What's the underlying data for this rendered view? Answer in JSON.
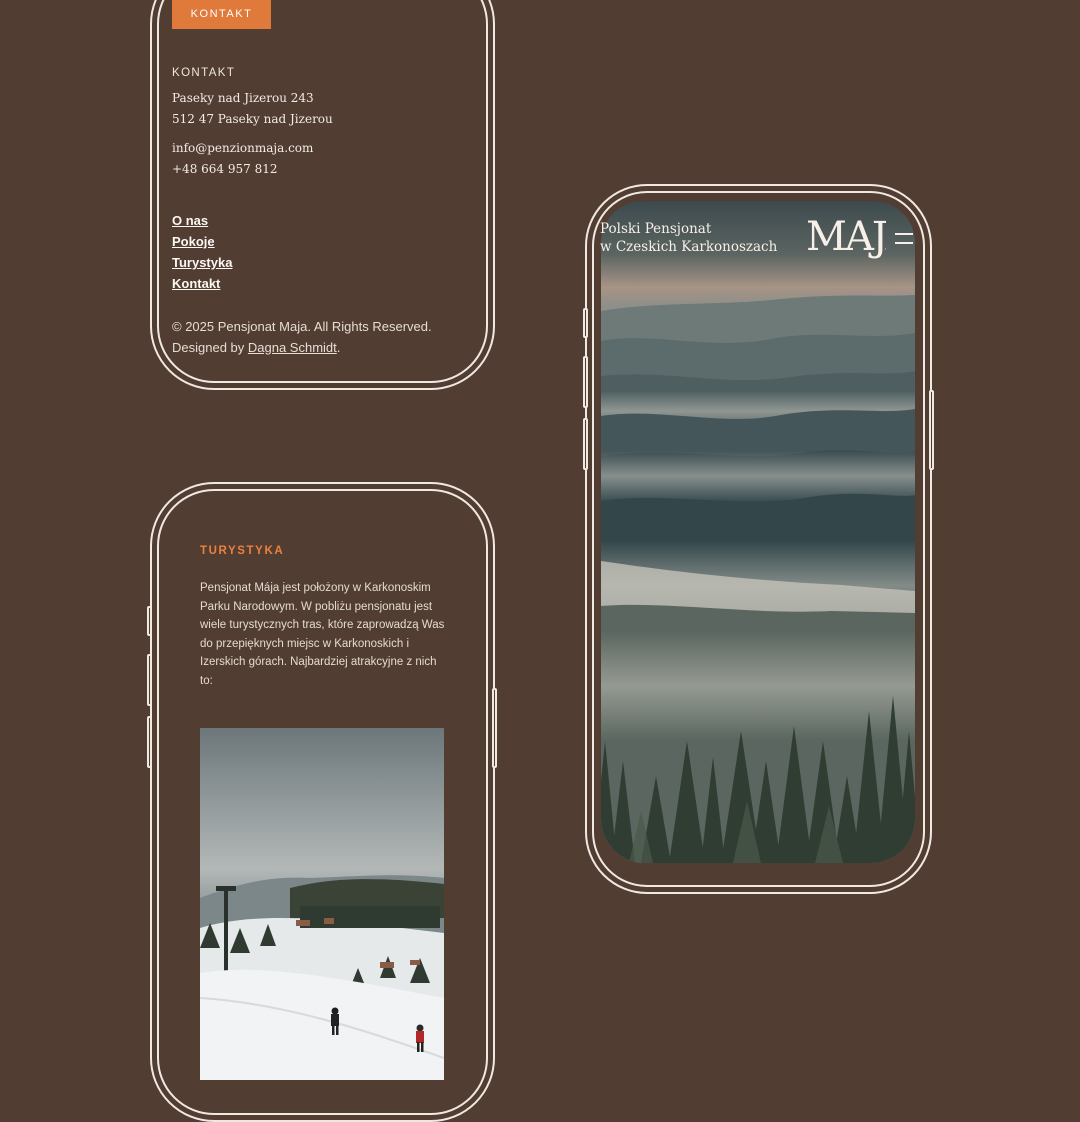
{
  "footer": {
    "contact_button": "KONTAKT",
    "contact_heading": "KONTAKT",
    "address_line1": "Paseky nad Jizerou 243",
    "address_line2": "512 47 Paseky nad Jizerou",
    "email": "info@penzionmaja.com",
    "phone": "+48 664 957 812",
    "nav": [
      "O nas",
      "Pokoje",
      "Turystyka",
      "Kontakt"
    ],
    "copyright": "© 2025 Pensjonat Maja. All Rights Reserved.",
    "designed_by_prefix": "Designed by ",
    "designer": "Dagna Schmidt",
    "designed_by_suffix": "."
  },
  "hero": {
    "tagline_line1": "Polski Pensjonat",
    "tagline_line2": "w Czeskich Karkonoszach",
    "logo_text": "MAJA",
    "menu_icon": "hamburger-menu-icon"
  },
  "tourism": {
    "title": "TURYSTYKA",
    "body": "Pensjonat Mája jest położony w Karkonoskim Parku Narodowym. W pobliżu pensjonatu jest wiele turystycznych tras, które zaprowadzą Was do przepięknych miejsc w Karkonoskich i Izerskich górach. Najbardziej atrakcyjne z nich to:"
  },
  "colors": {
    "background": "#523d33",
    "accent": "#e07a3a",
    "frame": "#f0e9e2"
  }
}
